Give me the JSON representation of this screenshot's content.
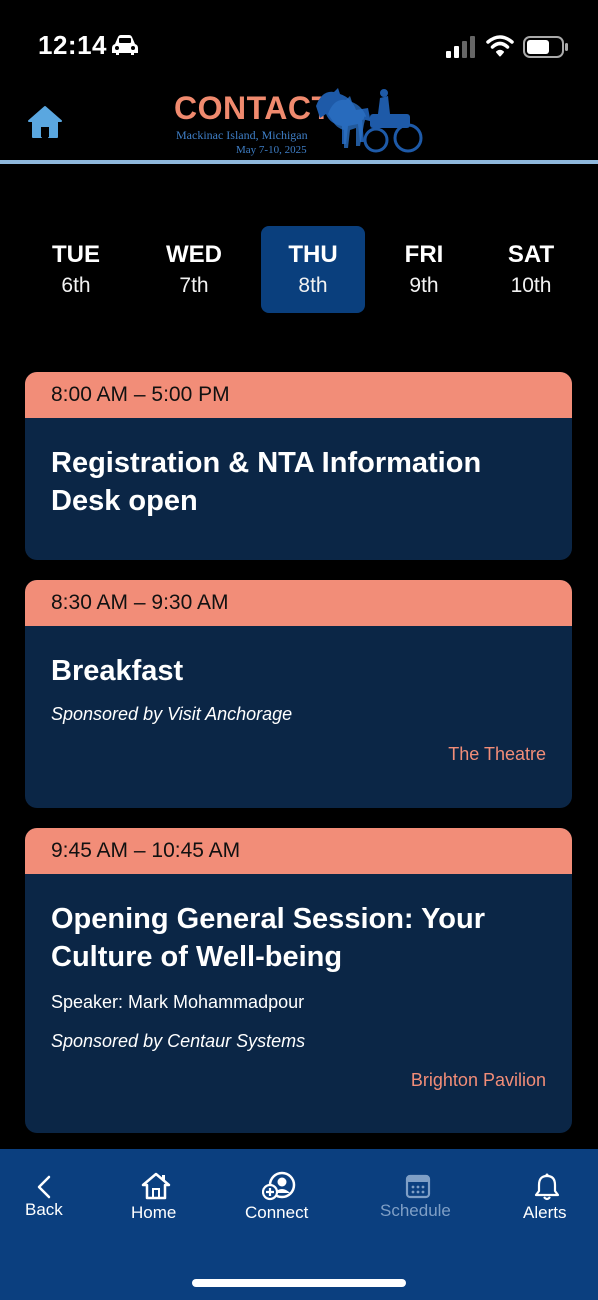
{
  "status_bar": {
    "time": "12:14"
  },
  "header": {
    "logo_title": "CONTACT",
    "logo_location": "Mackinac Island, Michigan",
    "logo_dates": "May 7-10, 2025"
  },
  "days": [
    {
      "name": "TUE",
      "date": "6th",
      "active": false
    },
    {
      "name": "WED",
      "date": "7th",
      "active": false
    },
    {
      "name": "THU",
      "date": "8th",
      "active": true
    },
    {
      "name": "FRI",
      "date": "9th",
      "active": false
    },
    {
      "name": "SAT",
      "date": "10th",
      "active": false
    }
  ],
  "events": [
    {
      "time": "8:00 AM – 5:00 PM",
      "title": "Registration & NTA Information Desk open"
    },
    {
      "time": "8:30 AM – 9:30 AM",
      "title": "Breakfast",
      "sponsor": "Sponsored by Visit Anchorage",
      "location": "The Theatre"
    },
    {
      "time": "9:45 AM – 10:45 AM",
      "title": "Opening General Session: Your Culture of Well-being",
      "speaker": "Speaker: Mark Mohammadpour",
      "sponsor": "Sponsored by Centaur Systems",
      "location": "Brighton Pavilion"
    }
  ],
  "nav": {
    "back": "Back",
    "home": "Home",
    "connect": "Connect",
    "schedule": "Schedule",
    "alerts": "Alerts"
  },
  "colors": {
    "accent": "#f28d78",
    "card": "#0b2646",
    "active_tab": "#0a3f7d",
    "nav_bg": "#0b3f7f"
  }
}
